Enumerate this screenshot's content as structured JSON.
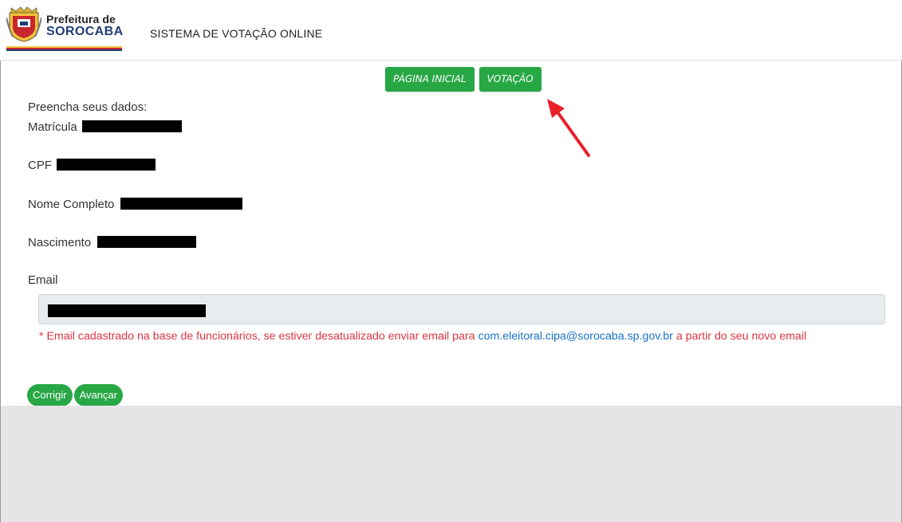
{
  "header": {
    "logo_line1": "Prefeitura de",
    "logo_line2": "SOROCABA",
    "system_title": "SISTEMA DE VOTAÇÃO ONLINE"
  },
  "nav": {
    "home_label": "PÁGINA INICIAL",
    "vote_label": "VOTAÇÃO"
  },
  "form": {
    "intro": "Preencha seus dados:",
    "fields": [
      {
        "label": "Matrícula",
        "value_redacted": true
      },
      {
        "label": "CPF",
        "value_redacted": true
      },
      {
        "label": "Nome Completo",
        "value_redacted": true
      },
      {
        "label": "Nascimento",
        "value_redacted": true
      }
    ],
    "email_label": "Email",
    "email_hint_prefix": "* Email cadastrado na base de funcionários, se estiver desatualizado enviar email para ",
    "email_hint_link": "com.eleitoral.cipa@sorocaba.sp.gov.br",
    "email_hint_suffix": " a partir do seu novo email"
  },
  "actions": {
    "correct_label": "Corrigir",
    "next_label": "Avançar"
  },
  "colors": {
    "accent_green": "#28a745",
    "hint_red": "#dc3545",
    "link_blue": "#1a73c8",
    "annotation_arrow": "#e8202a"
  },
  "icons": {
    "crest": "city-crest-icon",
    "annotation": "red-arrow-icon"
  }
}
